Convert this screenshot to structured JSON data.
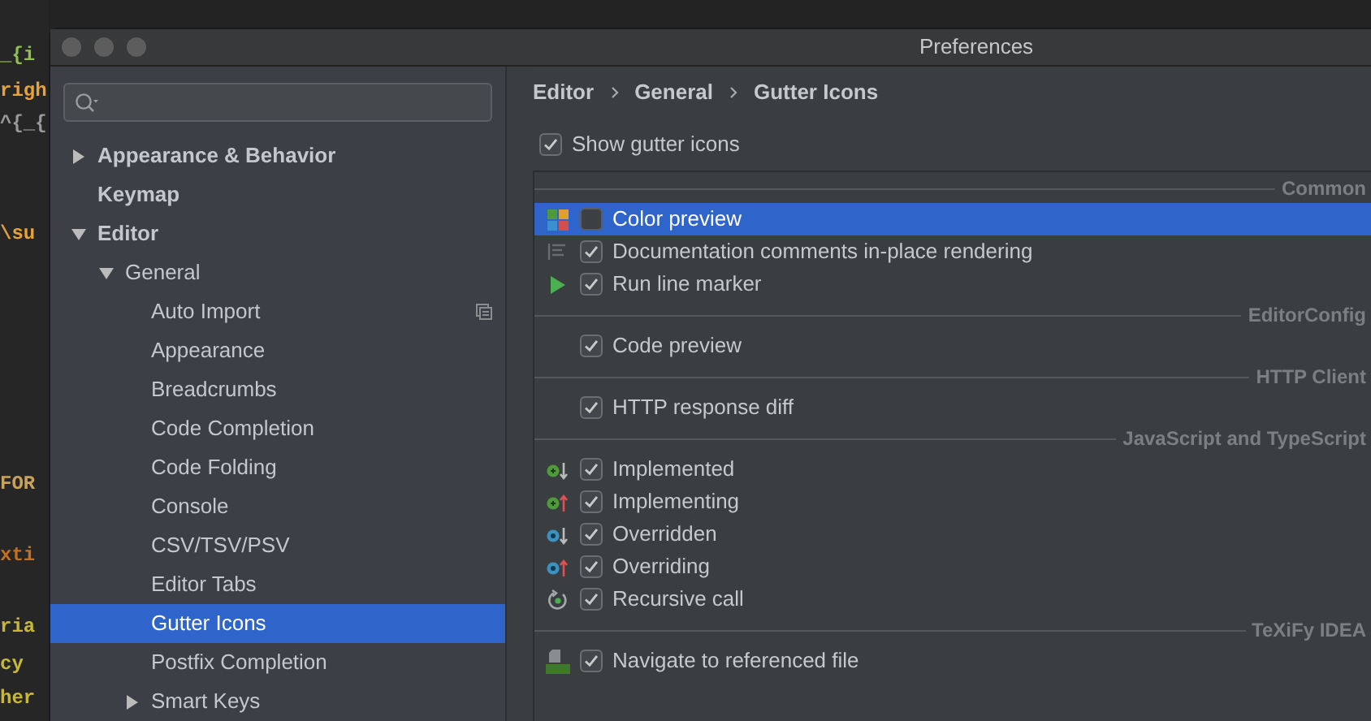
{
  "background_code": [
    {
      "text": "_{i",
      "color": "#8fbf4f"
    },
    {
      "text": "righ",
      "color": "#e8a23a"
    },
    {
      "text": "^{_{",
      "color": "#9a9a9a"
    },
    {
      "text": "\\su",
      "color": "#e8a23a"
    },
    {
      "text": "FOR",
      "color": "#c9a35a"
    },
    {
      "text": "xti",
      "color": "#c4701f"
    },
    {
      "text": "ria",
      "color": "#c7b83a"
    },
    {
      "text": "cy",
      "color": "#c7b83a"
    },
    {
      "text": "her",
      "color": "#c7b83a"
    }
  ],
  "window": {
    "title": "Preferences"
  },
  "sidebar": {
    "items": [
      {
        "label": "Appearance & Behavior",
        "expanded": false,
        "selected": false
      },
      {
        "label": "Keymap",
        "selected": false
      },
      {
        "label": "Editor",
        "expanded": true,
        "selected": false,
        "children": [
          {
            "label": "General",
            "expanded": true,
            "selected": false,
            "children": [
              {
                "label": "Auto Import",
                "selected": false,
                "scoped": true
              },
              {
                "label": "Appearance",
                "selected": false,
                "scoped": false
              },
              {
                "label": "Breadcrumbs",
                "selected": false,
                "scoped": false
              },
              {
                "label": "Code Completion",
                "selected": false,
                "scoped": false
              },
              {
                "label": "Code Folding",
                "selected": false,
                "scoped": false
              },
              {
                "label": "Console",
                "selected": false,
                "scoped": false
              },
              {
                "label": "CSV/TSV/PSV",
                "selected": false,
                "scoped": false
              },
              {
                "label": "Editor Tabs",
                "selected": false,
                "scoped": false
              },
              {
                "label": "Gutter Icons",
                "selected": true,
                "scoped": false
              },
              {
                "label": "Postfix Completion",
                "selected": false,
                "scoped": false
              },
              {
                "label": "Smart Keys",
                "expanded": false,
                "selected": false,
                "scoped": false
              }
            ]
          }
        ]
      }
    ]
  },
  "breadcrumb": [
    "Editor",
    "General",
    "Gutter Icons"
  ],
  "show_gutter_icons": {
    "label": "Show gutter icons",
    "checked": true
  },
  "groups": [
    {
      "title": "Common",
      "items": [
        {
          "label": "Color preview",
          "checked": false,
          "selected": true,
          "kind": "palette"
        },
        {
          "label": "Documentation comments in-place rendering",
          "checked": true,
          "selected": false,
          "kind": "doc"
        },
        {
          "label": "Run line marker",
          "checked": true,
          "selected": false,
          "kind": "run"
        }
      ]
    },
    {
      "title": "EditorConfig",
      "items": [
        {
          "label": "Code preview",
          "checked": true,
          "selected": false,
          "kind": "none"
        }
      ]
    },
    {
      "title": "HTTP Client",
      "items": [
        {
          "label": "HTTP response diff",
          "checked": true,
          "selected": false,
          "kind": "none"
        }
      ]
    },
    {
      "title": "JavaScript and TypeScript",
      "items": [
        {
          "label": "Implemented",
          "checked": true,
          "selected": false,
          "kind": "implemented"
        },
        {
          "label": "Implementing",
          "checked": true,
          "selected": false,
          "kind": "implementing"
        },
        {
          "label": "Overridden",
          "checked": true,
          "selected": false,
          "kind": "overridden"
        },
        {
          "label": "Overriding",
          "checked": true,
          "selected": false,
          "kind": "overriding"
        },
        {
          "label": "Recursive call",
          "checked": true,
          "selected": false,
          "kind": "recursive"
        }
      ]
    },
    {
      "title": "TeXiFy IDEA",
      "items": [
        {
          "label": "Navigate to referenced file",
          "checked": true,
          "selected": false,
          "kind": "tex"
        }
      ]
    }
  ]
}
